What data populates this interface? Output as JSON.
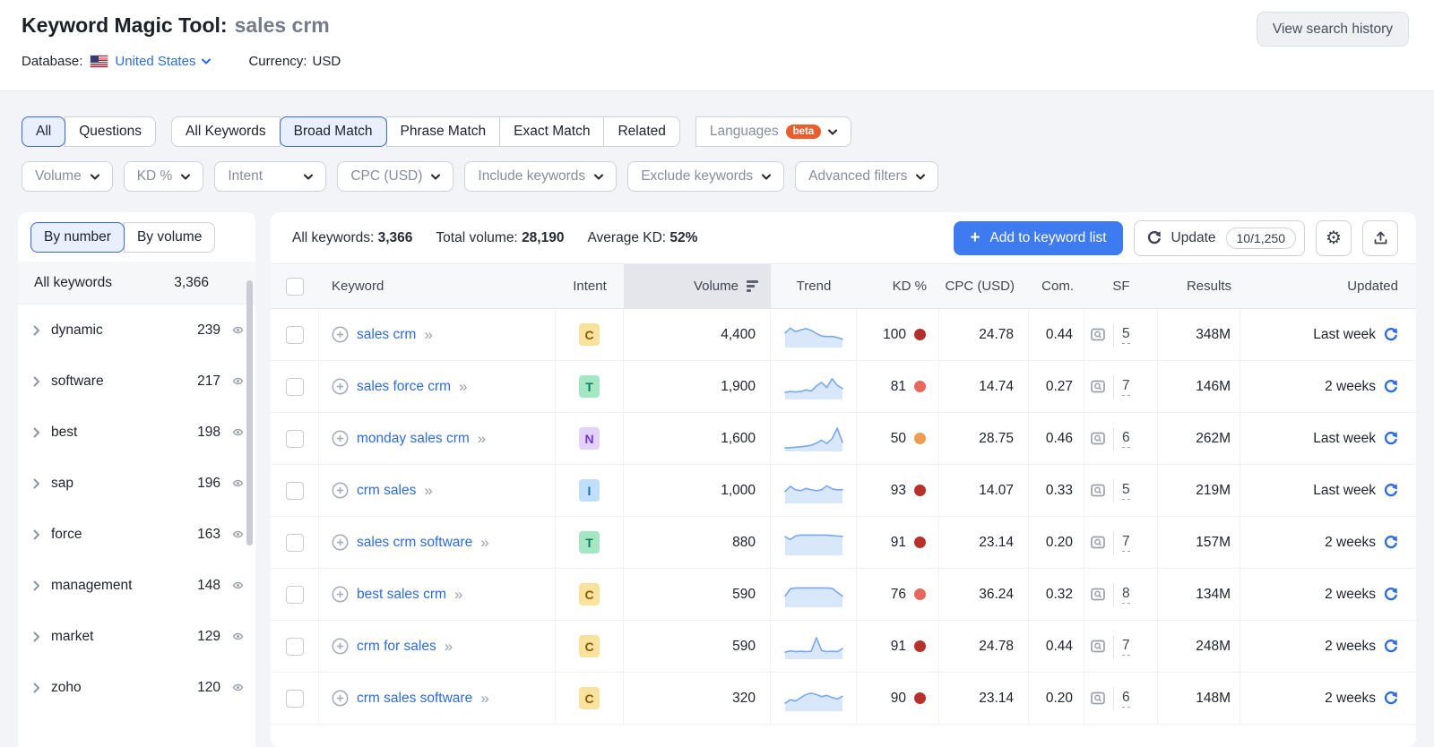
{
  "header": {
    "title": "Keyword Magic Tool:",
    "query": "sales crm",
    "view_history": "View search history",
    "database_label": "Database:",
    "database_value": "United States",
    "currency_label": "Currency:",
    "currency_value": "USD"
  },
  "filters": {
    "question_tabs": [
      "All",
      "Questions"
    ],
    "selected_question_tab": "All",
    "match_tabs": [
      "All Keywords",
      "Broad Match",
      "Phrase Match",
      "Exact Match",
      "Related"
    ],
    "selected_match_tab": "Broad Match",
    "languages_label": "Languages",
    "languages_beta": "beta",
    "dropdowns": [
      "Volume",
      "KD %",
      "Intent",
      "CPC (USD)",
      "Include keywords",
      "Exclude keywords",
      "Advanced filters"
    ]
  },
  "sidebar": {
    "tabs": [
      "By number",
      "By volume"
    ],
    "selected_tab": "By number",
    "all_row": {
      "label": "All keywords",
      "count": "3,366"
    },
    "groups": [
      {
        "label": "dynamic",
        "count": "239"
      },
      {
        "label": "software",
        "count": "217"
      },
      {
        "label": "best",
        "count": "198"
      },
      {
        "label": "sap",
        "count": "196"
      },
      {
        "label": "force",
        "count": "163"
      },
      {
        "label": "management",
        "count": "148"
      },
      {
        "label": "market",
        "count": "129"
      },
      {
        "label": "zoho",
        "count": "120"
      }
    ]
  },
  "toolbar": {
    "stats": [
      {
        "label": "All keywords:",
        "value": "3,366"
      },
      {
        "label": "Total volume:",
        "value": "28,190"
      },
      {
        "label": "Average KD:",
        "value": "52%"
      }
    ],
    "add_button": "Add to keyword list",
    "update_button": "Update",
    "update_quota": "10/1,250"
  },
  "intent_styles": {
    "C": {
      "bg": "#f8e29e",
      "fg": "#8a5c06"
    },
    "T": {
      "bg": "#a5e7c4",
      "fg": "#0e7d5e"
    },
    "N": {
      "bg": "#e3d3fb",
      "fg": "#7436cc"
    },
    "I": {
      "bg": "#bfdffb",
      "fg": "#1a6ac0"
    }
  },
  "table": {
    "columns": {
      "keyword": "Keyword",
      "intent": "Intent",
      "volume": "Volume",
      "trend": "Trend",
      "kd": "KD %",
      "cpc": "CPC (USD)",
      "com": "Com.",
      "sf": "SF",
      "results": "Results",
      "updated": "Updated"
    },
    "rows": [
      {
        "keyword": "sales crm",
        "intent": "C",
        "volume": "4,400",
        "kd": "100",
        "kd_color": "#b2302b",
        "cpc": "24.78",
        "com": "0.44",
        "sf": "5",
        "results": "348M",
        "updated": "Last week",
        "trend": [
          60,
          82,
          66,
          74,
          80,
          72,
          58,
          46,
          44,
          44,
          40,
          32
        ]
      },
      {
        "keyword": "sales force crm",
        "intent": "T",
        "volume": "1,900",
        "kd": "81",
        "kd_color": "#e8685e",
        "cpc": "14.74",
        "com": "0.27",
        "sf": "7",
        "results": "146M",
        "updated": "2 weeks",
        "trend": [
          26,
          30,
          28,
          30,
          38,
          32,
          55,
          72,
          48,
          88,
          58,
          44
        ]
      },
      {
        "keyword": "monday sales crm",
        "intent": "N",
        "volume": "1,600",
        "kd": "50",
        "kd_color": "#f09a52",
        "cpc": "28.75",
        "com": "0.46",
        "sf": "6",
        "results": "262M",
        "updated": "Last week",
        "trend": [
          10,
          11,
          13,
          15,
          18,
          22,
          32,
          45,
          30,
          52,
          100,
          35
        ]
      },
      {
        "keyword": "crm sales",
        "intent": "I",
        "volume": "1,000",
        "kd": "93",
        "kd_color": "#b7302a",
        "cpc": "14.07",
        "com": "0.33",
        "sf": "5",
        "results": "219M",
        "updated": "Last week",
        "trend": [
          48,
          72,
          56,
          52,
          62,
          56,
          52,
          56,
          74,
          60,
          56,
          56
        ]
      },
      {
        "keyword": "sales crm software",
        "intent": "T",
        "volume": "880",
        "kd": "91",
        "kd_color": "#b7302a",
        "cpc": "23.14",
        "com": "0.20",
        "sf": "7",
        "results": "157M",
        "updated": "2 weeks",
        "trend": [
          78,
          66,
          82,
          86,
          86,
          86,
          86,
          86,
          86,
          84,
          82,
          80
        ]
      },
      {
        "keyword": "best sales crm",
        "intent": "C",
        "volume": "590",
        "kd": "76",
        "kd_color": "#e8685e",
        "cpc": "36.24",
        "com": "0.32",
        "sf": "8",
        "results": "134M",
        "updated": "2 weeks",
        "trend": [
          45,
          78,
          82,
          82,
          82,
          82,
          82,
          82,
          82,
          80,
          62,
          45
        ]
      },
      {
        "keyword": "crm for sales",
        "intent": "C",
        "volume": "590",
        "kd": "91",
        "kd_color": "#b7302a",
        "cpc": "24.78",
        "com": "0.44",
        "sf": "7",
        "results": "248M",
        "updated": "2 weeks",
        "trend": [
          26,
          32,
          28,
          30,
          28,
          30,
          92,
          34,
          28,
          30,
          28,
          42
        ]
      },
      {
        "keyword": "crm sales software",
        "intent": "C",
        "volume": "320",
        "kd": "90",
        "kd_color": "#b7302a",
        "cpc": "23.14",
        "com": "0.20",
        "sf": "6",
        "results": "148M",
        "updated": "2 weeks",
        "trend": [
          30,
          46,
          40,
          56,
          70,
          76,
          70,
          60,
          66,
          56,
          50,
          62
        ]
      }
    ]
  }
}
